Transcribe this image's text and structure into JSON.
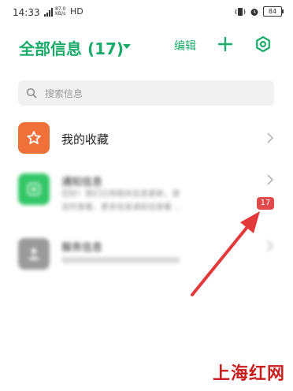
{
  "status_bar": {
    "time": "14:33",
    "network_speed": "87.0 KB/s",
    "hd_label": "HD",
    "battery": "84"
  },
  "header": {
    "title": "全部信息 (17)",
    "edit_label": "编辑",
    "add_icon": "plus-icon",
    "settings_icon": "settings-icon"
  },
  "search": {
    "placeholder": "搜索信息"
  },
  "list": {
    "favorites": {
      "title": "我的收藏",
      "icon": "star-icon",
      "color": "#f0703a"
    },
    "notifications": {
      "title": "通知信息",
      "preview_line1": "您好！我们已将相关信息更新，请",
      "preview_line2": "及时查看，更多信息请前往查看 ...",
      "badge": "17",
      "icon": "notification-icon",
      "color": "#32c668"
    },
    "service": {
      "title": "服务信息",
      "icon": "service-icon",
      "color": "#9a9a9a"
    }
  },
  "annotation": {
    "arrow_color": "#e23a3a"
  },
  "watermark": "上海红网",
  "colors": {
    "accent": "#1aaa6a",
    "badge": "#e04a4a"
  }
}
